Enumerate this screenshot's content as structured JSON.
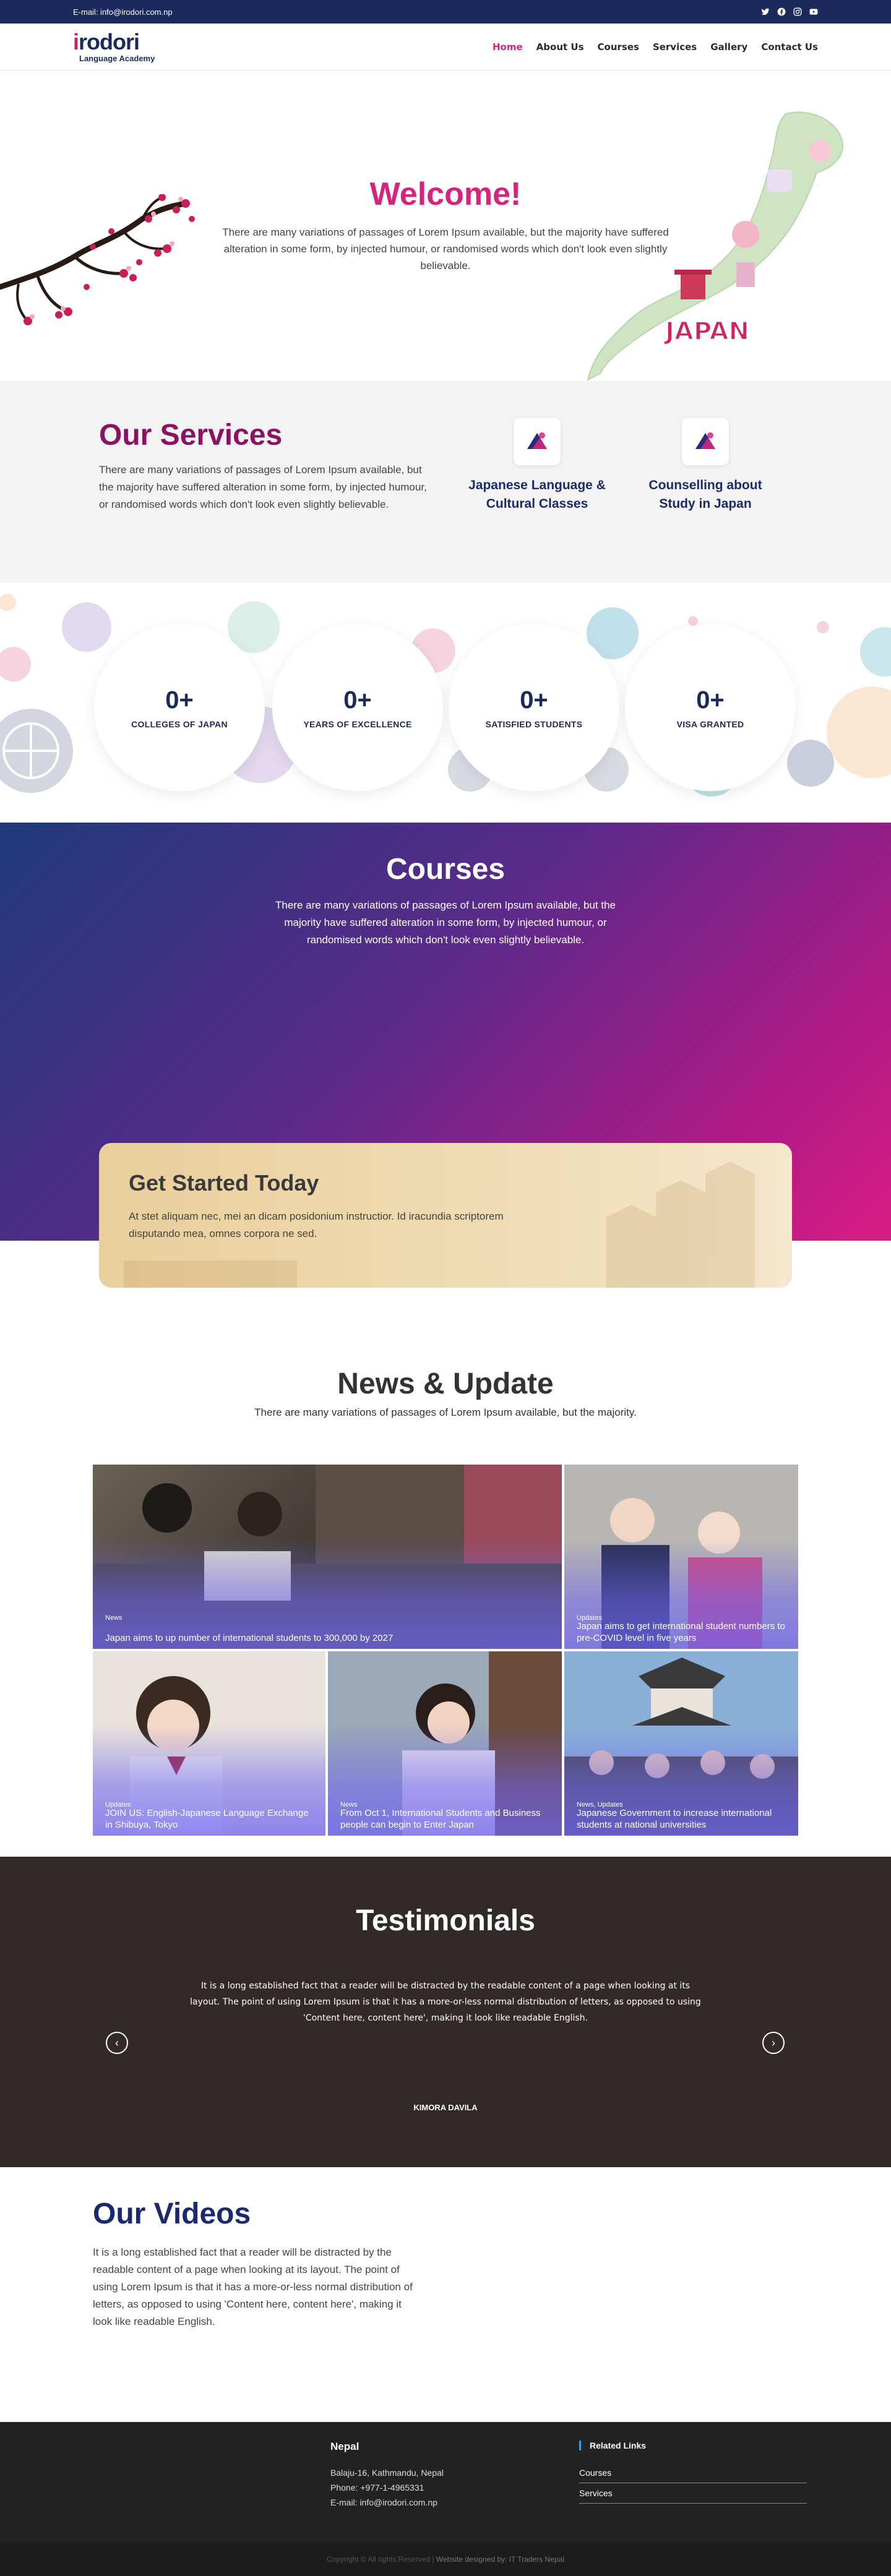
{
  "topbar": {
    "email": "E-mail: info@irodori.com.np",
    "socials": [
      "twitter-icon",
      "facebook-icon",
      "instagram-icon",
      "youtube-icon"
    ]
  },
  "header": {
    "logo_part1": "i",
    "logo_part2": "rodori",
    "logo_sub": "Language Academy",
    "nav": [
      "Home",
      "About Us",
      "Courses",
      "Services",
      "Gallery",
      "Contact Us"
    ],
    "active": "Home"
  },
  "welcome": {
    "title": "Welcome!",
    "text": "There are many variations of passages of Lorem Ipsum available, but the majority have suffered alteration in some form, by injected humour, or randomised words which don't look even slightly believable.",
    "map_label": "JAPAN"
  },
  "services": {
    "title": "Our Services",
    "text": "There are many variations of passages of Lorem Ipsum available, but the majority have suffered alteration in some form, by injected humour, or randomised words which don't look even slightly believable.",
    "cards": [
      {
        "title": "Japanese Language & Cultural Classes"
      },
      {
        "title": "Counselling about Study in Japan"
      }
    ]
  },
  "stats": [
    {
      "value": "0+",
      "label": "COLLEGES OF JAPAN"
    },
    {
      "value": "0+",
      "label": "YEARS OF EXCELLENCE"
    },
    {
      "value": "0+",
      "label": "SATISFIED STUDENTS"
    },
    {
      "value": "0+",
      "label": "VISA GRANTED"
    }
  ],
  "courses": {
    "title": "Courses",
    "text": "There are many variations of passages of Lorem Ipsum available, but the majority have suffered alteration in some form, by injected humour, or randomised words which don't look even slightly believable."
  },
  "get_started": {
    "title": "Get Started Today",
    "text": "At stet aliquam nec, mei an dicam posidonium instructior. Id iracundia scriptorem disputando mea, omnes corpora ne sed."
  },
  "news": {
    "title": "News & Update",
    "subtitle": "There are many variations of passages of Lorem Ipsum available, but the majority.",
    "items": [
      {
        "category": "News",
        "title": "Japan aims to up number of international students to 300,000 by 2027"
      },
      {
        "category": "Updates",
        "title": "Japan aims to get international student numbers to pre-COVID level in five years"
      },
      {
        "category": "Updates",
        "title": "JOIN US: English-Japanese Language Exchange in Shibuya, Tokyo"
      },
      {
        "category": "News",
        "title": "From Oct 1, International Students and Business people can begin to Enter Japan"
      },
      {
        "category": "News, Updates",
        "title": "Japanese Government to increase international students at national universities"
      }
    ]
  },
  "testimonials": {
    "title": "Testimonials",
    "text": "It is a long established fact that a reader will be distracted by the readable content of a page when looking at its layout. The point of using Lorem Ipsum is that it has a more-or-less normal distribution of letters, as opposed to using 'Content here, content here', making it look like readable English.",
    "name": "KIMORA DAVILA"
  },
  "videos": {
    "title": "Our Videos",
    "text": "It is a long established fact that a reader will be distracted by the readable content of a page when looking at its layout. The point of using Lorem Ipsum is that it has a more-or-less normal distribution of letters, as opposed to using 'Content here, content here', making it look like readable English."
  },
  "footer": {
    "heading": "Nepal",
    "address": "Balaju-16, Kathmandu, Nepal",
    "phone": "Phone: +977-1-4965331",
    "email": "E-mail: info@irodori.com.np",
    "related_title": "Related Links",
    "links": [
      "Courses",
      "Services"
    ],
    "copyright": "Copyright © All rights Reserved",
    "credit": "Website designed by: IT Traders Nepal"
  },
  "colors": {
    "navy": "#1b2a5c",
    "pink": "#d6247c",
    "plum": "#8a1262",
    "testimonial_bg": "#322a28",
    "footer_bg": "#222222"
  }
}
